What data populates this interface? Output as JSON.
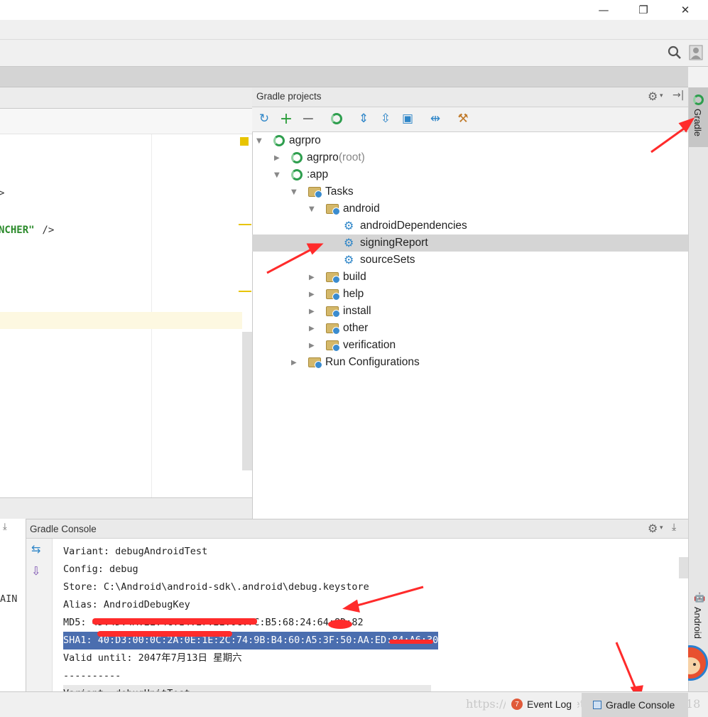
{
  "window": {
    "minimize_label": "—",
    "restore_label": "❐",
    "close_label": "✕"
  },
  "editor": {
    "code_fragment_1": ">",
    "code_fragment_2": "NCHER\"",
    "code_fragment_3": " />"
  },
  "gradle_panel": {
    "title": "Gradle projects",
    "tree": [
      {
        "label": "agrpro",
        "suffix": ""
      },
      {
        "label": "agrpro",
        "suffix": " (root)"
      },
      {
        "label": ":app",
        "suffix": ""
      },
      {
        "label": "Tasks"
      },
      {
        "label": "android"
      },
      {
        "label": "androidDependencies"
      },
      {
        "label": "signingReport"
      },
      {
        "label": "sourceSets"
      },
      {
        "label": "build"
      },
      {
        "label": "help"
      },
      {
        "label": "install"
      },
      {
        "label": "other"
      },
      {
        "label": "verification"
      },
      {
        "label": "Run Configurations"
      }
    ]
  },
  "right_stripe": {
    "gradle_label": "Gradle",
    "android_label": "Android"
  },
  "console": {
    "title": "Gradle Console",
    "left_fragment": "AIN",
    "lines": [
      "Variant: debugAndroidTest",
      "Config: debug",
      "Store: C:\\Android\\android-sdk\\.android\\debug.keystore",
      "Alias: AndroidDebugKey",
      "MD5: 4D:4D:4A:2E:4C:14:E7:2E:0C:7C:B5:68:24:64:8D:82",
      "SHA1: 40:D3:00:0C:2A:0E:1E:2C:74:9B:B4:60:A5:3F:50:AA:ED:84:A6:30",
      "Valid until: 2047年7月13日 星期六",
      "----------",
      "Variant: debugUnitTest"
    ]
  },
  "statusbar": {
    "watermark": "https://blog.csdn.net/",
    "watermark_tail": "18",
    "event_log_count": "7",
    "event_log_label": "Event Log",
    "gradle_console_label": "Gradle Console"
  },
  "colors": {
    "selection": "#d5d5d5",
    "highlight_line": "#fdf8e1",
    "sha_selection": "#4b6eaf",
    "annotation_red": "#ff2b2b",
    "gradle_green": "#2e9e4e"
  }
}
